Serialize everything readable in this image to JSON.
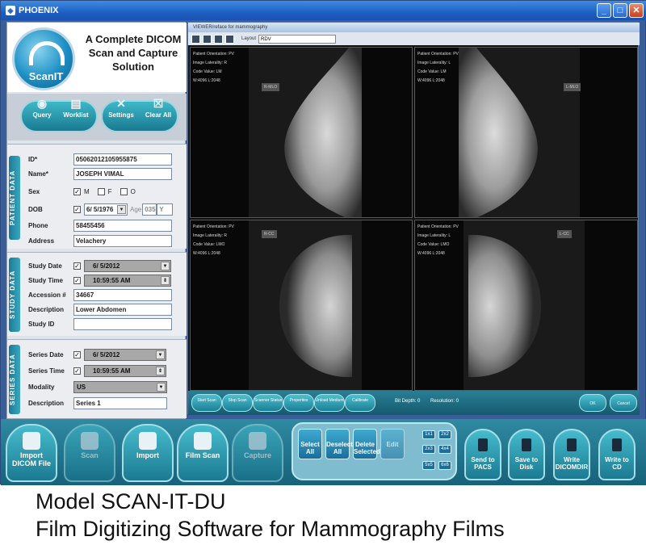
{
  "window": {
    "title": "PHOENIX",
    "controls": [
      "_",
      "□",
      "✕"
    ]
  },
  "brand": {
    "logo_text": "ScanIT",
    "tagline": "A Complete DICOM Scan and Capture Solution"
  },
  "toolbar_top": {
    "buttons": [
      {
        "label": "Query",
        "icon": "query-icon"
      },
      {
        "label": "Worklist",
        "icon": "worklist-icon"
      },
      {
        "label": "Settings",
        "icon": "settings-icon"
      },
      {
        "label": "Clear All",
        "icon": "clear-all-icon"
      }
    ]
  },
  "patient": {
    "tab": "PATIENT DATA",
    "id_label": "ID*",
    "id_value": "05062012105955875",
    "name_label": "Name*",
    "name_value": "JOSEPH VIMAL",
    "sex_label": "Sex",
    "sex_options": [
      "M",
      "F",
      "O"
    ],
    "sex_selected": "M",
    "dob_label": "DOB",
    "dob_value": "6/ 5/1976",
    "age_label": "Age",
    "age_value": "035",
    "age_unit": "Y",
    "phone_label": "Phone",
    "phone_value": "58455456",
    "address_label": "Address",
    "address_value": "Velachery"
  },
  "study": {
    "tab": "STUDY DATA",
    "date_label": "Study Date",
    "date_value": "6/ 5/2012",
    "time_label": "Study Time",
    "time_value": "10:59:55 AM",
    "accession_label": "Accession #",
    "accession_value": "34667",
    "description_label": "Description",
    "description_value": "Lower Abdomen",
    "studyid_label": "Study ID",
    "studyid_value": ""
  },
  "series": {
    "tab": "SERIES DATA",
    "date_label": "Series Date",
    "date_value": "6/ 5/2012",
    "time_label": "Series Time",
    "time_value": "10:59:55 AM",
    "modality_label": "Modality",
    "modality_value": "US",
    "description_label": "Description",
    "description_value": "Series 1"
  },
  "viewer": {
    "title": "VIEWER/reface for mammography",
    "layout_label": "Layout",
    "layout_value": "RDV",
    "quadrants": [
      {
        "lines": [
          "Patient Orientation: PV",
          "Image Laterality: R",
          "Code Value: LM",
          "W:4096 L:2048"
        ],
        "label": "R-MLO"
      },
      {
        "lines": [
          "Patient Orientation: PV",
          "Image Laterality: L",
          "Code Value: LM",
          "W:4096 L:2048"
        ],
        "label": "L-MLO"
      },
      {
        "lines": [
          "Patient Orientation: PV",
          "Image Laterality: R",
          "Code Value: LMO",
          "W:4096 L:2048"
        ],
        "label": "R-CC"
      },
      {
        "lines": [
          "Patient Orientation: PV",
          "Image Laterality: L",
          "Code Value: LMO",
          "W:4096 L:2048"
        ],
        "label": "L-CC"
      }
    ],
    "bottom_buttons": [
      "Start Scan",
      "Stop Scan",
      "Scanner Status",
      "Properties",
      "Unload Medium",
      "Calibrate"
    ],
    "bit_depth_label": "Bit Depth: 0",
    "resolution_label": "Resolution: 0",
    "ok_label": "OK",
    "cancel_label": "Cancel"
  },
  "bottom_toolbar": {
    "main_buttons": [
      {
        "label": "Import DICOM File",
        "icon": "import-dicom-icon",
        "enabled": true
      },
      {
        "label": "Scan",
        "icon": "scan-icon",
        "enabled": false
      },
      {
        "label": "Import",
        "icon": "import-icon",
        "enabled": true
      },
      {
        "label": "Film Scan",
        "icon": "film-scan-icon",
        "enabled": true
      },
      {
        "label": "Capture",
        "icon": "capture-icon",
        "enabled": false
      }
    ],
    "selection_buttons": [
      {
        "label": "Select All",
        "enabled": true
      },
      {
        "label": "Deselect All",
        "enabled": true
      },
      {
        "label": "Delete Selected",
        "enabled": true
      },
      {
        "label": "Edit",
        "enabled": false
      }
    ],
    "grid_buttons": [
      "1x1",
      "2x2",
      "2x3",
      "4x4",
      "5x5",
      "6x6"
    ],
    "output_buttons": [
      {
        "label": "Send to PACS",
        "icon": "send-pacs-icon"
      },
      {
        "label": "Save to Disk",
        "icon": "save-disk-icon"
      },
      {
        "label": "Write DICOMDIR",
        "icon": "write-dicomdir-icon"
      },
      {
        "label": "Write to CD",
        "icon": "write-cd-icon"
      }
    ]
  },
  "caption": {
    "line1": "Model SCAN-IT-DU",
    "line2": "Film Digitizing Software for Mammography Films"
  },
  "colors": {
    "accent": "#1b7a92",
    "titlebar": "#1f5fc4",
    "panel": "#dfe3ea"
  }
}
